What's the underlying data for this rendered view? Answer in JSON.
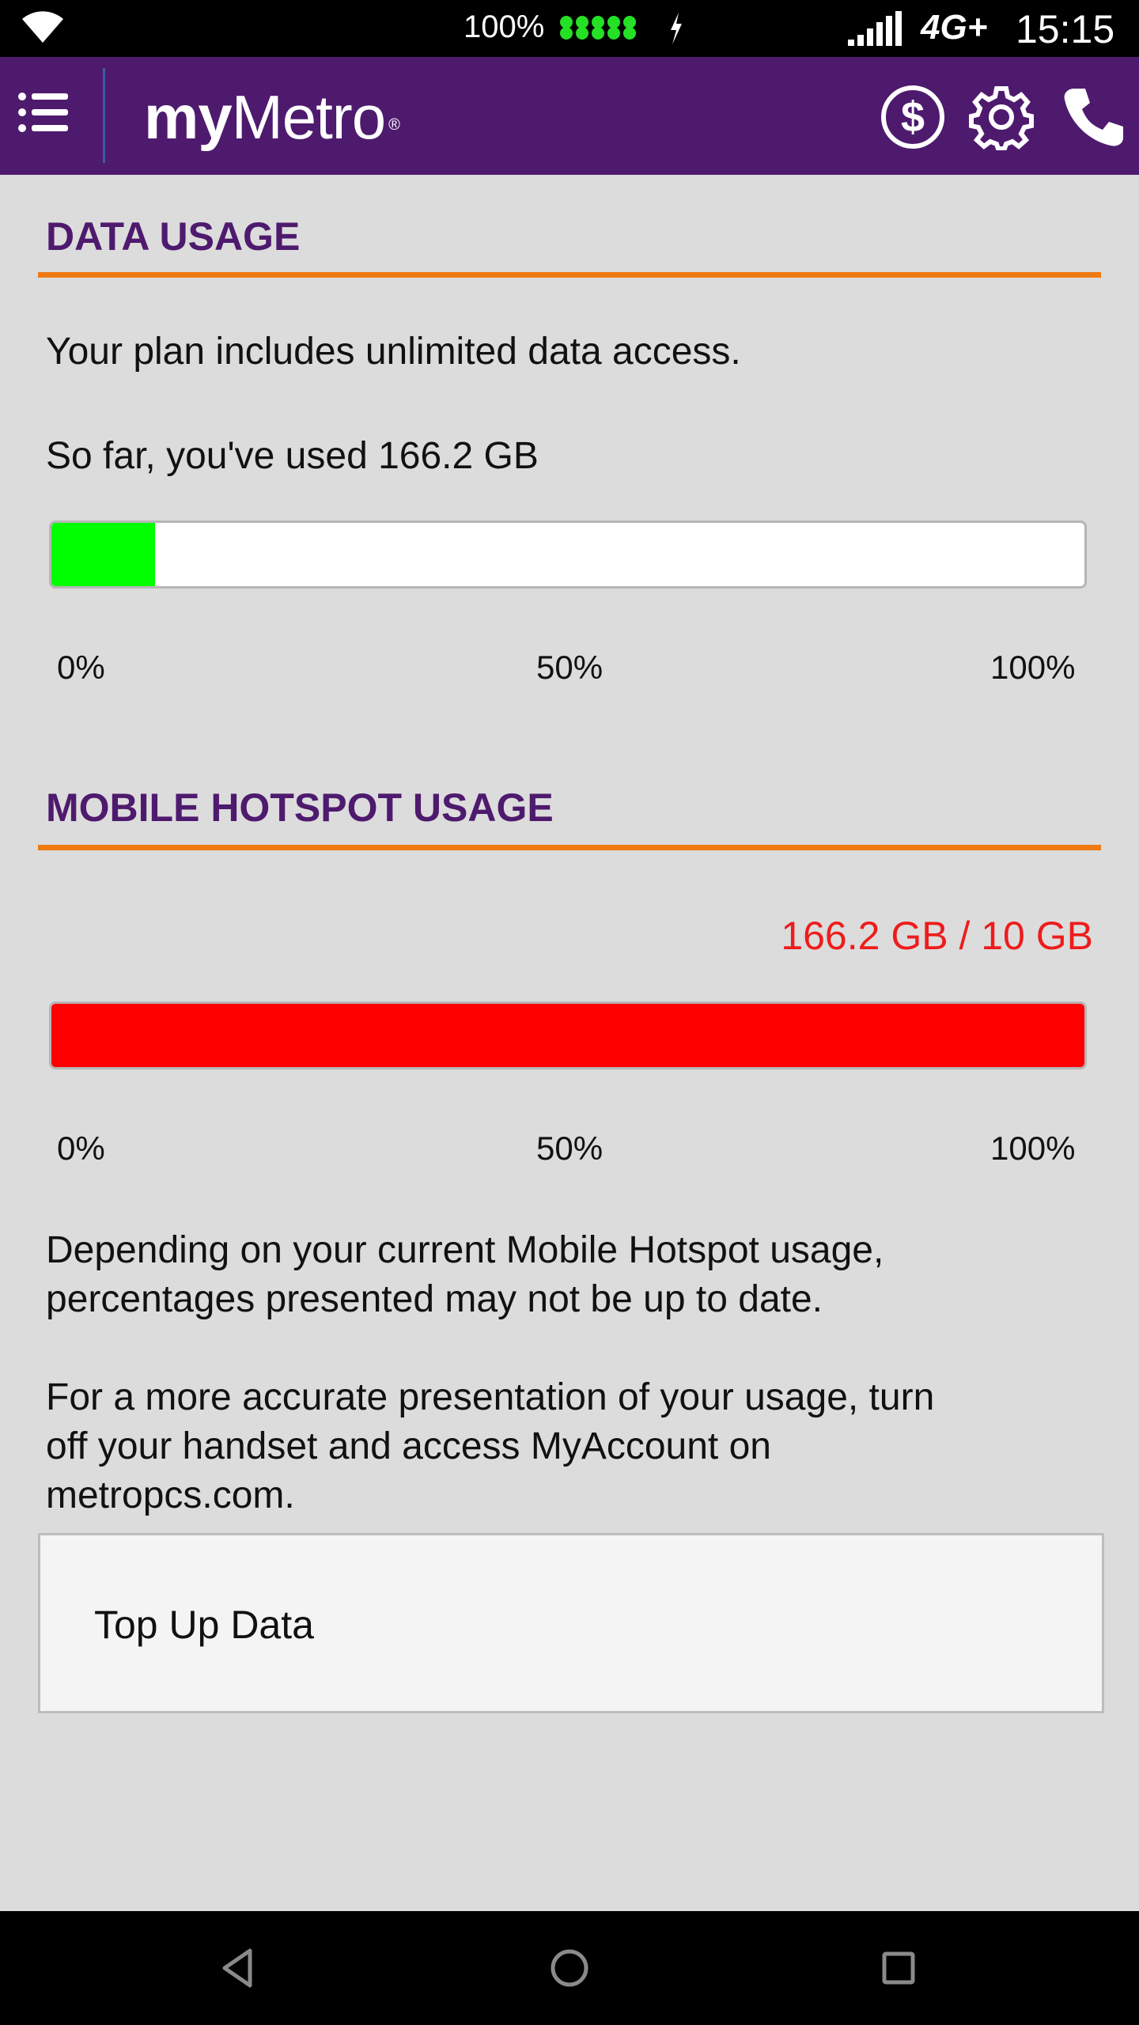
{
  "status_bar": {
    "battery_percent": "100%",
    "network": "4G+",
    "time": "15:15"
  },
  "app_bar": {
    "logo_bold": "my",
    "logo_light": "Metro",
    "logo_mark": "®",
    "icons": [
      "menu-icon",
      "dollar-icon",
      "gear-icon",
      "phone-icon"
    ]
  },
  "data_usage": {
    "title": "DATA USAGE",
    "plan_text": "Your plan includes unlimited data access.",
    "used_text": "So far, you've used 166.2 GB",
    "progress_fraction": 0.1,
    "fill_color": "#00ff00",
    "ticks": [
      "0%",
      "50%",
      "100%"
    ]
  },
  "hotspot_usage": {
    "title": "MOBILE HOTSPOT USAGE",
    "amount_text": "166.2 GB / 10 GB",
    "progress_fraction": 1.0,
    "fill_color": "#ff0000",
    "ticks": [
      "0%",
      "50%",
      "100%"
    ],
    "note_1_line_1": "Depending on your current Mobile Hotspot usage,",
    "note_1_line_2": "percentages presented may not be up to date.",
    "note_2_line_1": "For a more accurate presentation of your usage, turn",
    "note_2_line_2": "off your handset and access MyAccount on",
    "note_2_line_3": "metropcs.com."
  },
  "top_up": {
    "label": "Top Up Data"
  },
  "colors": {
    "brand_purple": "#4e1a6e",
    "accent_orange": "#f07a14",
    "warning_red": "#ee1c1c"
  }
}
